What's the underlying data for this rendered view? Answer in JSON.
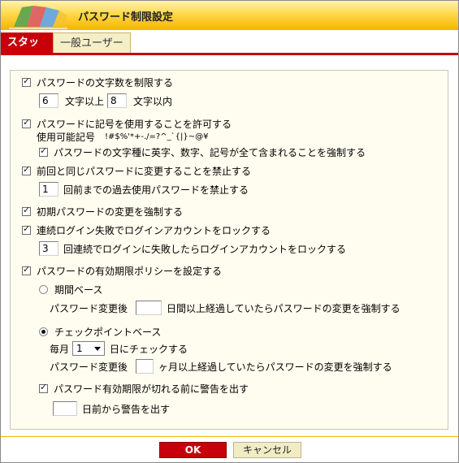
{
  "window": {
    "title": "パスワード制限設定"
  },
  "tabs": [
    {
      "label": "スタッフ",
      "active": true
    },
    {
      "label": "一般ユーザー",
      "active": false
    }
  ],
  "settings": {
    "length": {
      "checked": true,
      "label": "パスワードの文字数を制限する",
      "min": "6",
      "min_suffix": "文字以上",
      "max": "8",
      "max_suffix": "文字以内"
    },
    "symbols": {
      "checked": true,
      "label": "パスワードに記号を使用することを許可する",
      "allowed_label": "使用可能記号",
      "allowed_chars": "!#$%'*+-./=?^_`{|}~@¥",
      "force_mix": {
        "checked": true,
        "label": "パスワードの文字種に英字、数字、記号が全て含まれることを強制する"
      }
    },
    "reuse": {
      "checked": true,
      "label": "前回と同じパスワードに変更することを禁止する",
      "count": "1",
      "count_suffix": "回前までの過去使用パスワードを禁止する"
    },
    "force_initial_change": {
      "checked": true,
      "label": "初期パスワードの変更を強制する"
    },
    "lockout": {
      "checked": true,
      "label": "連続ログイン失敗でログインアカウントをロックする",
      "count": "3",
      "count_suffix": "回連続でログインに失敗したらログインアカウントをロックする"
    },
    "expiry": {
      "checked": true,
      "label": "パスワードの有効期限ポリシーを設定する",
      "period": {
        "selected": false,
        "label": "期間ベース",
        "prefix": "パスワード変更後",
        "value": "",
        "suffix": "日間以上経過していたらパスワードの変更を強制する"
      },
      "checkpoint": {
        "selected": true,
        "label": "チェックポイントベース",
        "monthly_prefix": "毎月",
        "day": "1",
        "monthly_suffix": "日にチェックする",
        "prefix": "パスワード変更後",
        "value": "",
        "suffix": "ヶ月以上経過していたらパスワードの変更を強制する"
      },
      "warn": {
        "checked": true,
        "label": "パスワード有効期限が切れる前に警告を出す",
        "value": "",
        "suffix": "日前から警告を出す"
      }
    }
  },
  "buttons": {
    "ok": "OK",
    "cancel": "キャンセル"
  }
}
